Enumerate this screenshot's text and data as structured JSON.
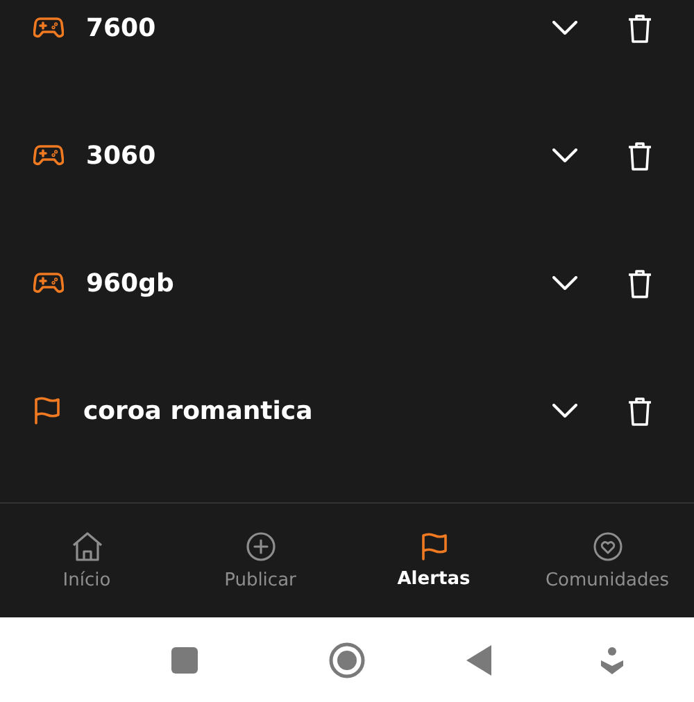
{
  "alerts": [
    {
      "kind": "game",
      "label": "7600"
    },
    {
      "kind": "game",
      "label": "3060"
    },
    {
      "kind": "game",
      "label": "960gb"
    },
    {
      "kind": "flag",
      "label": "coroa romantica"
    }
  ],
  "nav": [
    {
      "kind": "home",
      "label": "Início",
      "selected": false
    },
    {
      "kind": "plus",
      "label": "Publicar",
      "selected": false
    },
    {
      "kind": "flag",
      "label": "Alertas",
      "selected": true
    },
    {
      "kind": "heart",
      "label": "Comunidades",
      "selected": false
    }
  ]
}
